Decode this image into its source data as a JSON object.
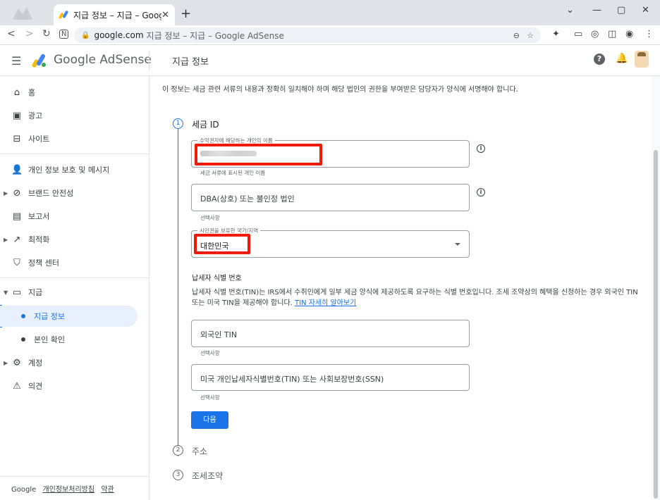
{
  "browser": {
    "tab_title": "지급 정보 – 지급 – Google AdSense",
    "url_host": "google.com",
    "url_rest": "지급 정보 – 지급 – Google AdSense"
  },
  "header": {
    "brand": "Google AdSense",
    "page_title": "지급 정보",
    "help_label": "?"
  },
  "sidebar": {
    "items": [
      {
        "label": "홈"
      },
      {
        "label": "광고"
      },
      {
        "label": "사이트"
      },
      {
        "label": "개인 정보 보호 및 메시지"
      },
      {
        "label": "브랜드 안전성"
      },
      {
        "label": "보고서"
      },
      {
        "label": "최적화"
      },
      {
        "label": "정책 센터"
      },
      {
        "label": "지급"
      },
      {
        "label": "지급 정보"
      },
      {
        "label": "본인 확인"
      },
      {
        "label": "계정"
      },
      {
        "label": "의견"
      }
    ],
    "footer": {
      "google": "Google",
      "privacy": "개인정보처리방침",
      "terms": "약관"
    }
  },
  "main": {
    "notice": "이 정보는 세금 관련 서류의 내용과 정확히 일치해야 하며 해당 법인의 권한을 부여받은 담당자가 양식에 서명해야 합니다.",
    "step1": {
      "num": "1",
      "title": "세금 ID"
    },
    "name_field": {
      "label": "수익권자에 해당하는 개인의 이름",
      "hint": "세금 서류에 표시된 개인 이름"
    },
    "dba_field": {
      "placeholder": "DBA(상호) 또는 불인정 법인",
      "hint": "선택사항"
    },
    "country_field": {
      "label": "시민권을 보유한 국가/지역",
      "value": "대한민국"
    },
    "tin_section": {
      "title": "납세자 식별 번호",
      "desc": "납세자 식별 번호(TIN)는 IRS에서 수취인에게 일부 세금 양식에 제공하도록 요구하는 식별 번호입니다. 조세 조약상의 혜택을 신청하는 경우 외국인 TIN 또는 미국 TIN을 제공해야 합니다.",
      "link": "TIN 자세히 알아보기"
    },
    "foreign_tin": {
      "placeholder": "외국인 TIN",
      "hint": "선택사항"
    },
    "us_tin": {
      "placeholder": "미국 개인납세자식별번호(TIN) 또는 사회보장번호(SSN)",
      "hint": "선택사항"
    },
    "next_button": "다음",
    "step2": {
      "num": "2",
      "title": "주소"
    },
    "step3": {
      "num": "3",
      "title": "조세조약"
    }
  },
  "colors": {
    "accent": "#1a73e8",
    "highlight": "#f01a0a"
  }
}
